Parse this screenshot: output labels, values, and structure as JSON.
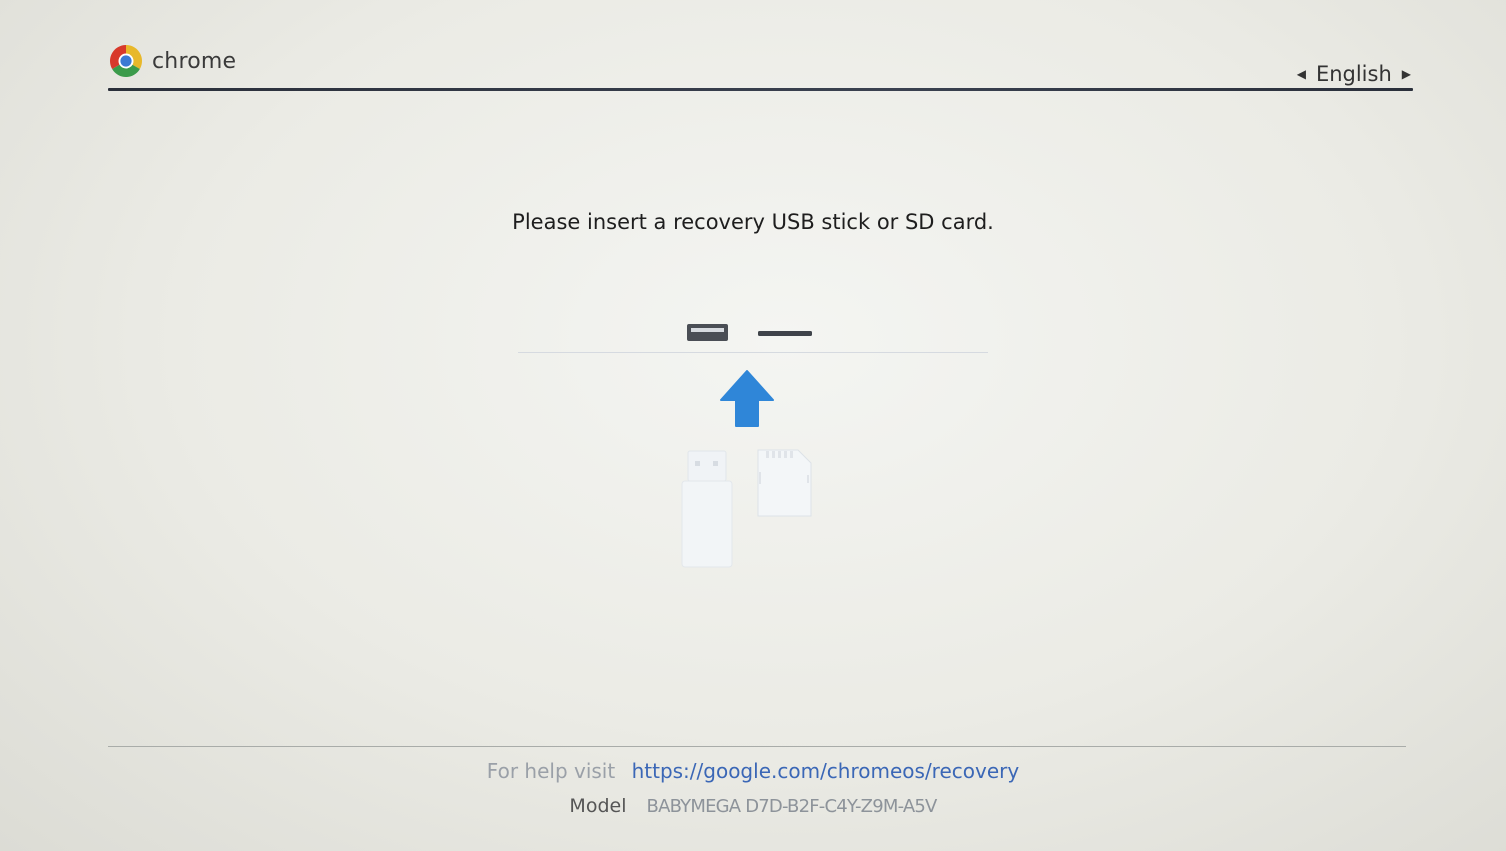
{
  "header": {
    "brand": "chrome",
    "language": "English",
    "icons": {
      "logo": "chrome-logo-icon",
      "prev": "triangle-left-icon",
      "next": "triangle-right-icon"
    }
  },
  "main": {
    "message": "Please insert a recovery USB stick or SD card.",
    "icons": {
      "usb_slot": "usb-slot-icon",
      "sd_slot": "sd-slot-icon",
      "arrow": "arrow-up-icon",
      "usb_stick": "usb-stick-icon",
      "sd_card": "sd-card-icon"
    },
    "colors": {
      "arrow": "#2f86d8"
    }
  },
  "footer": {
    "help_text": "For help visit",
    "help_link": "https://google.com/chromeos/recovery",
    "model_label": "Model",
    "model_value": "BABYMEGA D7D-B2F-C4Y-Z9M-A5V"
  }
}
